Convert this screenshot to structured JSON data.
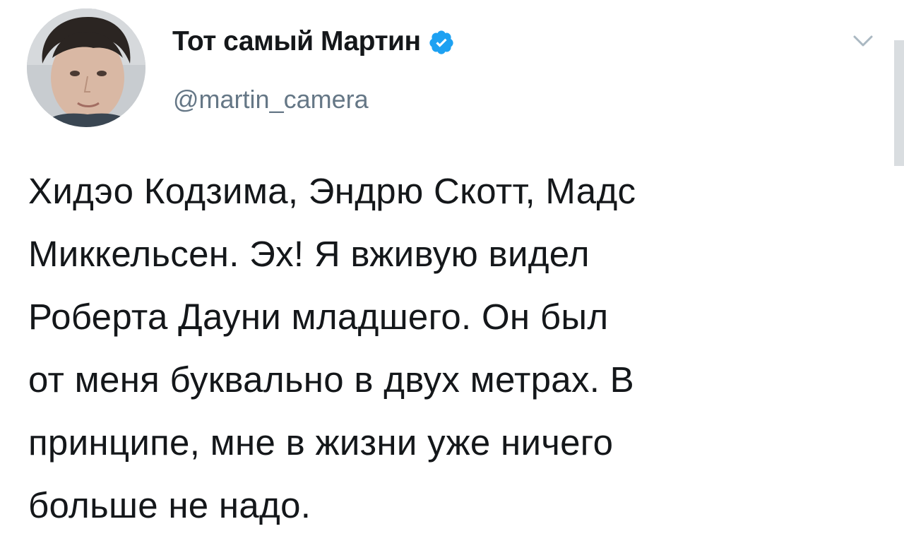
{
  "tweet": {
    "author": {
      "display_name": "Тот самый Мартин",
      "handle": "@martin_camera",
      "verified": true,
      "avatar_icon": "avatar-photo"
    },
    "menu_icon": "chevron-down-icon",
    "text": "Хидэо Кодзима, Эндрю Скотт, Мадс\nМиккельсен. Эх! Я вживую видел\nРоберта Дауни младшего. Он был\nот меня буквально в двух метрах. В\nпринципе, мне в жизни уже ничего\nбольше не надо."
  },
  "colors": {
    "name": "#14171a",
    "handle": "#657786",
    "verified_badge": "#1da1f2",
    "chevron": "#aab8c2",
    "background": "#ffffff"
  }
}
